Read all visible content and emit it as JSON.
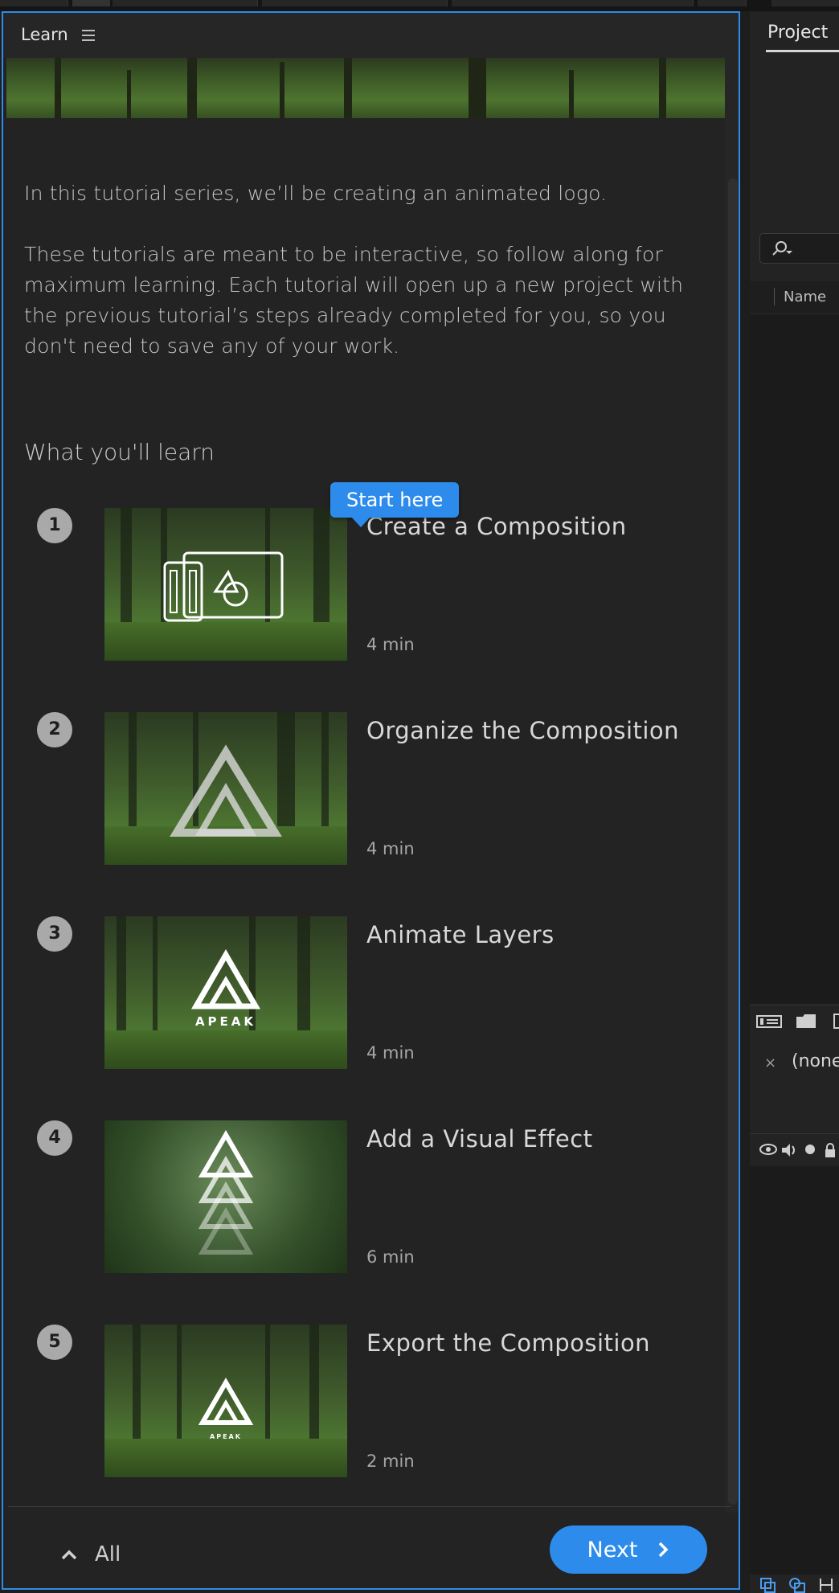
{
  "learn_panel": {
    "title": "Learn",
    "intro_1": "In this tutorial series, we’ll be creating an animated logo.",
    "intro_2": "These tutorials are meant to be interactive, so follow along for maximum learning. Each tutorial will open up a new project with the previous tutorial’s steps already completed for you, so you don't need to save any of your work.",
    "section_heading": "What you'll learn",
    "start_callout": "Start here",
    "lessons": [
      {
        "number": "1",
        "title": "Create a Composition",
        "duration": "4 min",
        "thumb_icon": "composition-icon"
      },
      {
        "number": "2",
        "title": "Organize the Composition",
        "duration": "4 min",
        "thumb_icon": "apeak-logo-outline-icon"
      },
      {
        "number": "3",
        "title": "Animate Layers",
        "duration": "4 min",
        "thumb_icon": "apeak-logo-icon",
        "thumb_text": "APEAK"
      },
      {
        "number": "4",
        "title": "Add a Visual Effect",
        "duration": "6 min",
        "thumb_icon": "apeak-logo-echo-icon"
      },
      {
        "number": "5",
        "title": "Export the Composition",
        "duration": "2 min",
        "thumb_icon": "apeak-logo-icon",
        "thumb_text": "APEAK"
      }
    ],
    "footer": {
      "all_label": "All",
      "next_label": "Next"
    }
  },
  "project_panel": {
    "tab_label": "Project",
    "column_name": "Name",
    "comp_tab_label": "(none",
    "comp_close": "×"
  },
  "colors": {
    "accent": "#2d8ceb",
    "panel_bg": "#232323",
    "number_badge": "#a9a9a9"
  }
}
